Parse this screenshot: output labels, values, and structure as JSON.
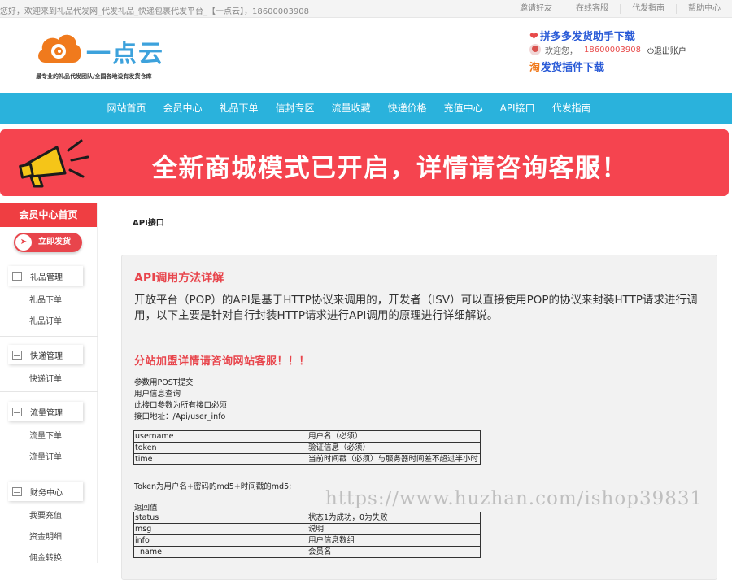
{
  "topbar": {
    "welcome": "您好，欢迎来到礼品代发网_代发礼品_快递包裹代发平台_【一点云】，18600003908",
    "links": [
      "邀请好友",
      "在线客服",
      "代发指南",
      "帮助中心"
    ]
  },
  "header": {
    "logo_name": "一点云",
    "logo_slogan": "最专业的礼品代发团队/全国各地设有发货仓库",
    "pdd_link": "拼多多发货助手下载",
    "welcome_label": "欢迎您，",
    "phone": "18600003908",
    "logout": "退出账户",
    "taobao_icon": "淘",
    "taobao_link": "发货插件下载"
  },
  "nav": {
    "items": [
      "网站首页",
      "会员中心",
      "礼品下单",
      "信封专区",
      "流量收藏",
      "快递价格",
      "充值中心",
      "API接口",
      "代发指南"
    ]
  },
  "banner": {
    "text": "全新商城模式已开启，详情请咨询客服！",
    "bg_color": "#f5444f"
  },
  "sidebar": {
    "title": "会员中心首页",
    "quick_button": "立即发货",
    "groups": [
      {
        "title": "礼品管理",
        "items": [
          "礼品下单",
          "礼品订单"
        ]
      },
      {
        "title": "快递管理",
        "items": [
          "快递订单"
        ]
      },
      {
        "title": "流量管理",
        "items": [
          "流量下单",
          "流量订单"
        ]
      },
      {
        "title": "财务中心",
        "items": [
          "我要充值",
          "资金明细",
          "佣金转换"
        ]
      }
    ]
  },
  "main": {
    "breadcrumb": "API接口",
    "heading": "API调用方法详解",
    "intro": "开放平台（POP）的API是基于HTTP协议来调用的，开发者（ISV）可以直接使用POP的协议来封装HTTP请求进行调用，以下主要是针对自行封装HTTP请求进行API调用的原理进行详细解说。",
    "subheading": "分站加盟详情请咨询网站客服！！！",
    "meta": [
      "参数用POST提交",
      "用户信息查询",
      "此接口参数为所有接口必须",
      "接口地址：/Api/user_info"
    ],
    "params": [
      {
        "key": "username",
        "desc": "用户名（必须）"
      },
      {
        "key": "token",
        "desc": "验证信息（必须）"
      },
      {
        "key": "time",
        "desc": "当前时间戳（必须）与服务器时间差不超过半小时"
      }
    ],
    "token_note": "Token为用户名+密码的md5+时间戳的md5;",
    "return_label": "返回值",
    "returns": [
      {
        "key": "status",
        "desc": "状态1为成功，0为失败"
      },
      {
        "key": "msg",
        "desc": "说明"
      },
      {
        "key": "info",
        "desc": "用户信息数组"
      },
      {
        "key": "  name",
        "desc": "会员名"
      }
    ]
  },
  "watermark": "https://www.huzhan.com/ishop39831"
}
